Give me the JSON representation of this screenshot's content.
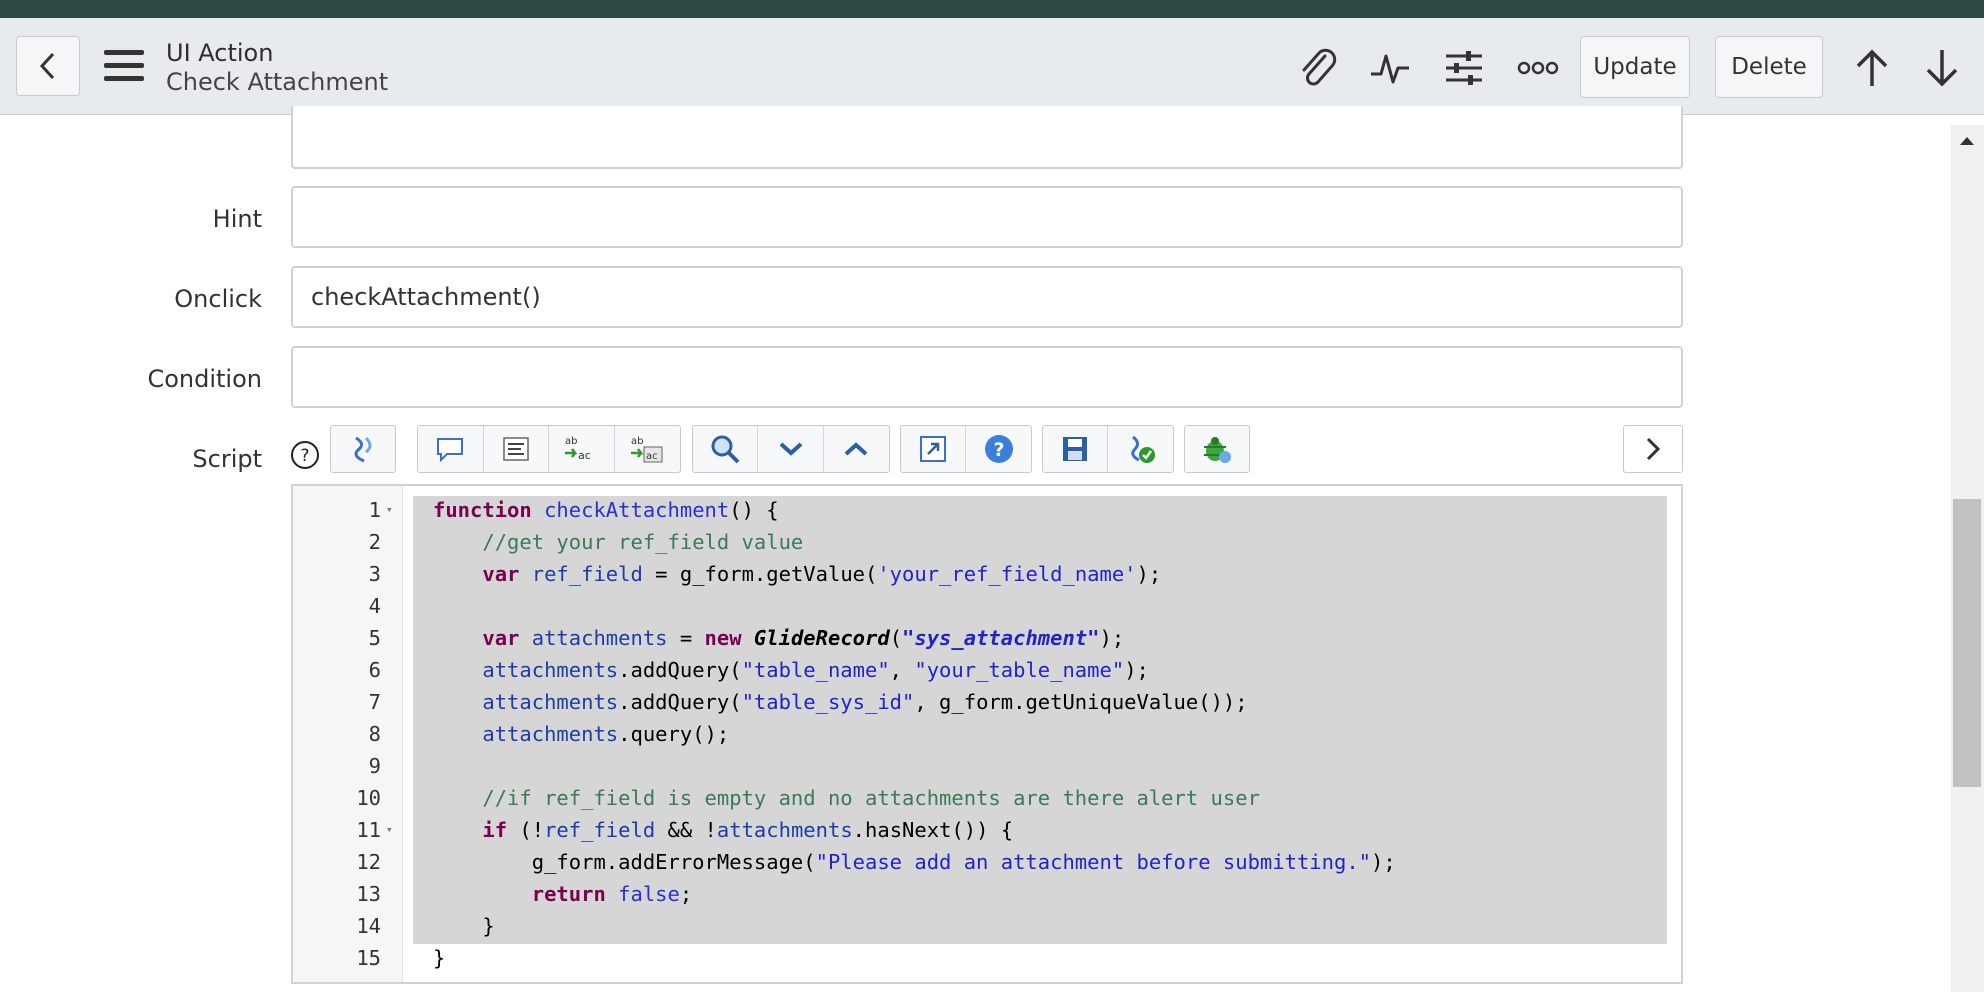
{
  "header": {
    "record_type": "UI Action",
    "record_name": "Check Attachment",
    "update_label": "Update",
    "delete_label": "Delete"
  },
  "form": {
    "hint_label": "Hint",
    "hint_value": "",
    "onclick_label": "Onclick",
    "onclick_value": "checkAttachment()",
    "condition_label": "Condition",
    "condition_value": "",
    "script_label": "Script"
  },
  "toolbar": {
    "icons": [
      "toggle-syntax-icon",
      "comment-icon",
      "format-icon",
      "replace-icon",
      "replace-all-icon",
      "search-icon",
      "search-next-icon",
      "search-previous-icon",
      "fullscreen-icon",
      "help-icon",
      "save-icon",
      "script-check-icon",
      "debug-icon"
    ]
  },
  "editor": {
    "lines": [
      {
        "num": "1",
        "fold": true,
        "segments": [
          {
            "t": "function",
            "c": "kw"
          },
          {
            "t": " ",
            "c": ""
          },
          {
            "t": "checkAttachment",
            "c": "fn"
          },
          {
            "t": "() {",
            "c": ""
          }
        ]
      },
      {
        "num": "2",
        "fold": false,
        "segments": [
          {
            "t": "    ",
            "c": ""
          },
          {
            "t": "//get your ref_field value",
            "c": "cm"
          }
        ]
      },
      {
        "num": "3",
        "fold": false,
        "segments": [
          {
            "t": "    ",
            "c": ""
          },
          {
            "t": "var",
            "c": "kw"
          },
          {
            "t": " ",
            "c": ""
          },
          {
            "t": "ref_field",
            "c": "var"
          },
          {
            "t": " = g_form.getValue(",
            "c": ""
          },
          {
            "t": "'your_ref_field_name'",
            "c": "str"
          },
          {
            "t": ");",
            "c": ""
          }
        ]
      },
      {
        "num": "4",
        "fold": false,
        "segments": []
      },
      {
        "num": "5",
        "fold": false,
        "segments": [
          {
            "t": "    ",
            "c": ""
          },
          {
            "t": "var",
            "c": "kw"
          },
          {
            "t": " ",
            "c": ""
          },
          {
            "t": "attachments",
            "c": "var"
          },
          {
            "t": " = ",
            "c": ""
          },
          {
            "t": "new",
            "c": "kw"
          },
          {
            "t": " ",
            "c": ""
          },
          {
            "t": "GlideRecord",
            "c": "cls"
          },
          {
            "t": "(",
            "c": ""
          },
          {
            "t": "\"sys_attachment\"",
            "c": "stri"
          },
          {
            "t": ");",
            "c": ""
          }
        ]
      },
      {
        "num": "6",
        "fold": false,
        "segments": [
          {
            "t": "    ",
            "c": ""
          },
          {
            "t": "attachments",
            "c": "var"
          },
          {
            "t": ".addQuery(",
            "c": ""
          },
          {
            "t": "\"table_name\"",
            "c": "str"
          },
          {
            "t": ", ",
            "c": ""
          },
          {
            "t": "\"your_table_name\"",
            "c": "str"
          },
          {
            "t": ");",
            "c": ""
          }
        ]
      },
      {
        "num": "7",
        "fold": false,
        "segments": [
          {
            "t": "    ",
            "c": ""
          },
          {
            "t": "attachments",
            "c": "var"
          },
          {
            "t": ".addQuery(",
            "c": ""
          },
          {
            "t": "\"table_sys_id\"",
            "c": "str"
          },
          {
            "t": ", g_form.getUniqueValue());",
            "c": ""
          }
        ]
      },
      {
        "num": "8",
        "fold": false,
        "segments": [
          {
            "t": "    ",
            "c": ""
          },
          {
            "t": "attachments",
            "c": "var"
          },
          {
            "t": ".query();",
            "c": ""
          }
        ]
      },
      {
        "num": "9",
        "fold": false,
        "segments": []
      },
      {
        "num": "10",
        "fold": false,
        "segments": [
          {
            "t": "    ",
            "c": ""
          },
          {
            "t": "//if ref_field is empty and no attachments are there alert user",
            "c": "cm"
          }
        ]
      },
      {
        "num": "11",
        "fold": true,
        "segments": [
          {
            "t": "    ",
            "c": ""
          },
          {
            "t": "if",
            "c": "kw"
          },
          {
            "t": " (!",
            "c": ""
          },
          {
            "t": "ref_field",
            "c": "var"
          },
          {
            "t": " && !",
            "c": ""
          },
          {
            "t": "attachments",
            "c": "var"
          },
          {
            "t": ".hasNext()) {",
            "c": ""
          }
        ]
      },
      {
        "num": "12",
        "fold": false,
        "segments": [
          {
            "t": "        g_form.addErrorMessage(",
            "c": ""
          },
          {
            "t": "\"Please add an attachment before submitting.\"",
            "c": "str"
          },
          {
            "t": ");",
            "c": ""
          }
        ]
      },
      {
        "num": "13",
        "fold": false,
        "segments": [
          {
            "t": "        ",
            "c": ""
          },
          {
            "t": "return",
            "c": "kw"
          },
          {
            "t": " ",
            "c": ""
          },
          {
            "t": "false",
            "c": "fn"
          },
          {
            "t": ";",
            "c": ""
          }
        ]
      },
      {
        "num": "14",
        "fold": false,
        "segments": [
          {
            "t": "    }",
            "c": ""
          }
        ]
      },
      {
        "num": "15",
        "fold": false,
        "segments": [
          {
            "t": "}",
            "c": ""
          }
        ]
      }
    ]
  },
  "colors": {
    "top_strip": "#2f4a45",
    "header_bg": "#e8ebed",
    "selection": "#d6d6d6"
  }
}
